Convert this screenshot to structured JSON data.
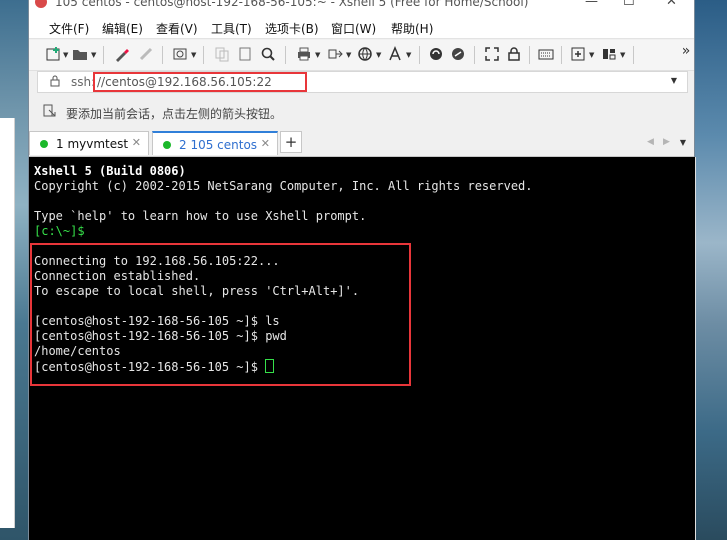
{
  "window": {
    "title": "105 centos - centos@host-192-168-56-105:~ - Xshell 5 (Free for Home/School)",
    "controls": {
      "minimize": "—",
      "maximize": "☐",
      "close": "✕"
    }
  },
  "menu": [
    "文件(F)",
    "编辑(E)",
    "查看(V)",
    "工具(T)",
    "选项卡(B)",
    "窗口(W)",
    "帮助(H)"
  ],
  "toolbar": {
    "icons": [
      "new-session-icon",
      "open-folder-icon",
      "properties-icon",
      "disconnect-icon",
      "connect-icon",
      "copy-icon",
      "paste-icon",
      "find-icon",
      "print-icon",
      "transfer-icon",
      "globe-icon",
      "font-icon",
      "xftp-icon",
      "script-icon",
      "fullscreen-icon",
      "lock-icon",
      "keyboard-icon",
      "new-tab-icon",
      "layout-icon",
      "more-icon"
    ],
    "overflow": "»"
  },
  "address": {
    "prefix": "ssh:",
    "value": "//centos@192.168.56.105:22",
    "highlight_color": "#e8363a"
  },
  "session_hint": "要添加当前会话，点击左侧的箭头按钮。",
  "tabs": [
    {
      "label": "1 myvmtest",
      "active": false
    },
    {
      "label": "2 105 centos",
      "active": true
    }
  ],
  "tab_add": "+",
  "tab_nav": {
    "prev": "◀",
    "next": "▶",
    "menu": "▼"
  },
  "terminal": {
    "lines": [
      "Xshell 5 (Build 0806)",
      "Copyright (c) 2002-2015 NetSarang Computer, Inc. All rights reserved.",
      "",
      "Type `help' to learn how to use Xshell prompt.",
      "[c:\\~]$",
      "",
      "Connecting to 192.168.56.105:22...",
      "Connection established.",
      "To escape to local shell, press 'Ctrl+Alt+]'.",
      "",
      "[centos@host-192-168-56-105 ~]$ ls",
      "[centos@host-192-168-56-105 ~]$ pwd",
      "/home/centos",
      "[centos@host-192-168-56-105 ~]$ "
    ],
    "prompt_color": "#36e04a",
    "background": "#000000"
  }
}
